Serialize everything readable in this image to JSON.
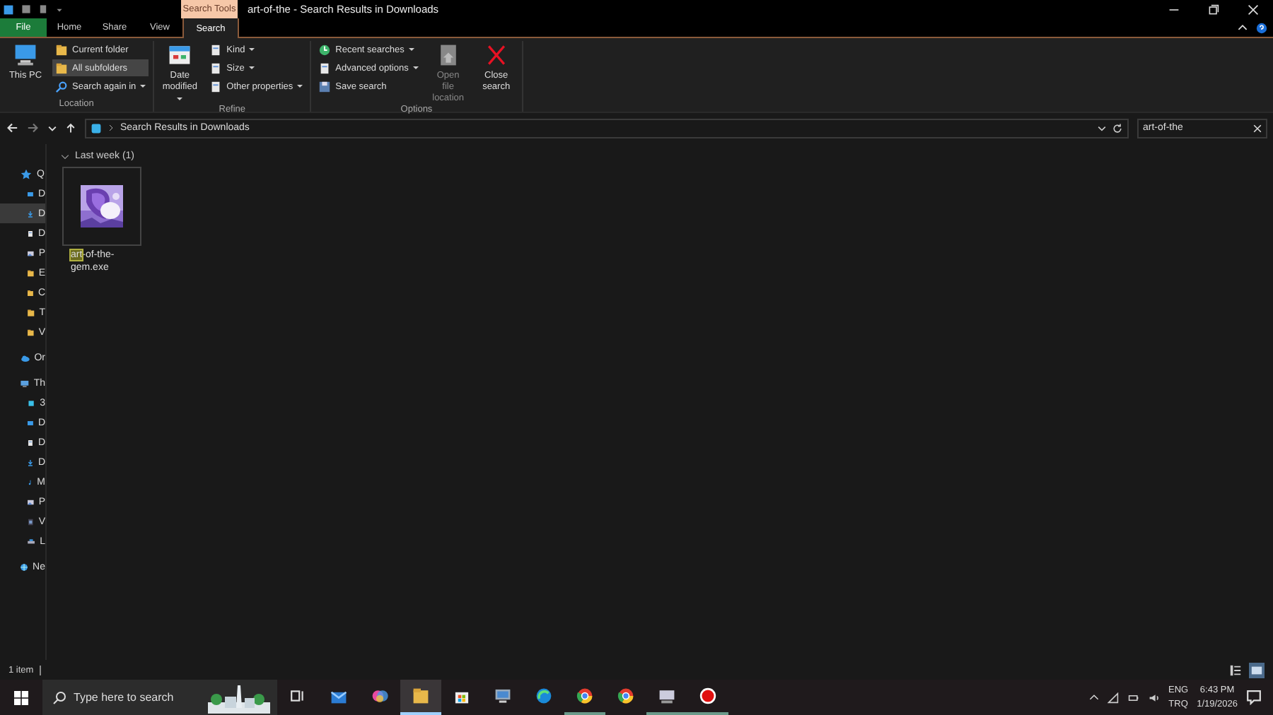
{
  "window": {
    "title": "art-of-the - Search Results in Downloads",
    "context_label": "Search Tools"
  },
  "ribbon_tabs": [
    {
      "label": "File",
      "kind": "file",
      "selected": false
    },
    {
      "label": "Home",
      "kind": "tab",
      "selected": false
    },
    {
      "label": "Share",
      "kind": "tab",
      "selected": false
    },
    {
      "label": "View",
      "kind": "tab",
      "selected": false
    },
    {
      "label": "Search",
      "kind": "tab",
      "selected": true
    }
  ],
  "ribbon_groups": [
    {
      "label": "Location",
      "large": [
        {
          "label": "This PC",
          "dropdown": false,
          "disabled": false
        }
      ],
      "small": [
        {
          "label": "Current folder",
          "dropdown": false,
          "selected": false
        },
        {
          "label": "All subfolders",
          "dropdown": false,
          "selected": true
        },
        {
          "label": "Search again in",
          "dropdown": true,
          "selected": false
        }
      ]
    },
    {
      "label": "Refine",
      "large": [
        {
          "label": "Date modified",
          "dropdown": true,
          "disabled": false
        }
      ],
      "small": [
        {
          "label": "Kind",
          "dropdown": true,
          "selected": false
        },
        {
          "label": "Size",
          "dropdown": true,
          "selected": false
        },
        {
          "label": "Other properties",
          "dropdown": true,
          "selected": false
        }
      ]
    },
    {
      "label": "Options",
      "small": [
        {
          "label": "Recent searches",
          "dropdown": true,
          "selected": false
        },
        {
          "label": "Advanced options",
          "dropdown": true,
          "selected": false
        },
        {
          "label": "Save search",
          "dropdown": false,
          "selected": false
        }
      ],
      "large": [
        {
          "label": "Open file location",
          "dropdown": false,
          "disabled": true
        },
        {
          "label": "Close search",
          "dropdown": false,
          "disabled": false
        }
      ]
    }
  ],
  "address": {
    "path": "Search Results in Downloads",
    "search_value": "art-of-the",
    "forward_disabled": true
  },
  "sidebar": {
    "items": [
      {
        "label": "Q",
        "selected": false,
        "children": [
          {
            "label": "D",
            "selected": false
          },
          {
            "label": "D",
            "selected": true
          },
          {
            "label": "D",
            "selected": false
          },
          {
            "label": "P",
            "selected": false
          },
          {
            "label": "E",
            "selected": false
          },
          {
            "label": "C",
            "selected": false
          },
          {
            "label": "T",
            "selected": false
          },
          {
            "label": "V",
            "selected": false
          }
        ]
      },
      {
        "label": "Or",
        "selected": false
      },
      {
        "label": "Th",
        "selected": false,
        "children": [
          {
            "label": "3",
            "selected": false
          },
          {
            "label": "D",
            "selected": false
          },
          {
            "label": "D",
            "selected": false
          },
          {
            "label": "D",
            "selected": false
          },
          {
            "label": "M",
            "selected": false
          },
          {
            "label": "P",
            "selected": false
          },
          {
            "label": "V",
            "selected": false
          },
          {
            "label": "L",
            "selected": false
          }
        ]
      },
      {
        "label": "Ne",
        "selected": false
      }
    ]
  },
  "content": {
    "group": {
      "label": "Last week (1)",
      "expanded": true
    },
    "files": [
      {
        "kind": "picture",
        "name_parts": [
          {
            "text": "art",
            "match": true
          },
          {
            "text": "-of-the-gem.exe",
            "match": false
          }
        ]
      }
    ]
  },
  "status_bar": {
    "count": "1 item",
    "view": [
      {
        "selected": false
      },
      {
        "selected": true
      }
    ]
  },
  "taskbar": {
    "search_placeholder": "Type here to search",
    "apps": [
      {
        "running": false,
        "selected": false
      },
      {
        "running": false,
        "selected": false
      },
      {
        "running": false,
        "selected": false
      },
      {
        "running": true,
        "selected": true
      },
      {
        "running": false,
        "selected": false
      },
      {
        "running": false,
        "selected": false
      },
      {
        "running": false,
        "selected": false
      },
      {
        "running": true,
        "selected": false
      },
      {
        "running": false,
        "selected": false
      },
      {
        "running": true,
        "selected": false
      },
      {
        "running": true,
        "selected": false
      }
    ],
    "language": [
      "ENG",
      "TRQ"
    ],
    "time": "6:43 PM",
    "date": "1/19/2026"
  }
}
